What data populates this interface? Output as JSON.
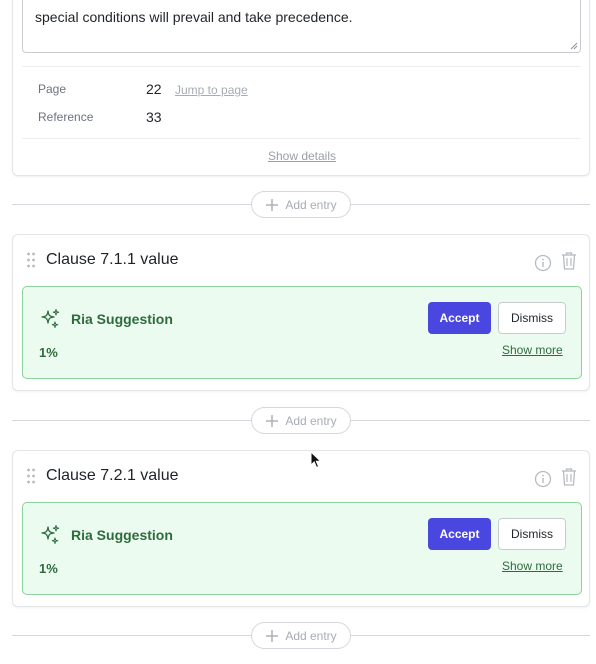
{
  "top_card": {
    "textarea_value": "special conditions will prevail and take precedence.",
    "page_label": "Page",
    "page_value": "22",
    "jump_label": "Jump to page",
    "reference_label": "Reference",
    "reference_value": "33",
    "show_details_label": "Show details"
  },
  "add_entry_label": "Add entry",
  "clauses": [
    {
      "title": "Clause 7.1.1 value",
      "suggestion": {
        "title": "Ria Suggestion",
        "value": "1%",
        "accept_label": "Accept",
        "dismiss_label": "Dismiss",
        "show_more_label": "Show more"
      }
    },
    {
      "title": "Clause 7.2.1 value",
      "suggestion": {
        "title": "Ria Suggestion",
        "value": "1%",
        "accept_label": "Accept",
        "dismiss_label": "Dismiss",
        "show_more_label": "Show more"
      }
    }
  ],
  "icons": {
    "drag": "drag-handle-icon",
    "info": "info-icon",
    "trash": "trash-icon",
    "sparkle": "sparkle-icon",
    "plus": "plus-icon"
  },
  "colors": {
    "accent": "#4a46e0",
    "suggestion_bg": "#ecfbef",
    "suggestion_border": "#8bd49a",
    "suggestion_text": "#2f6b3f"
  }
}
